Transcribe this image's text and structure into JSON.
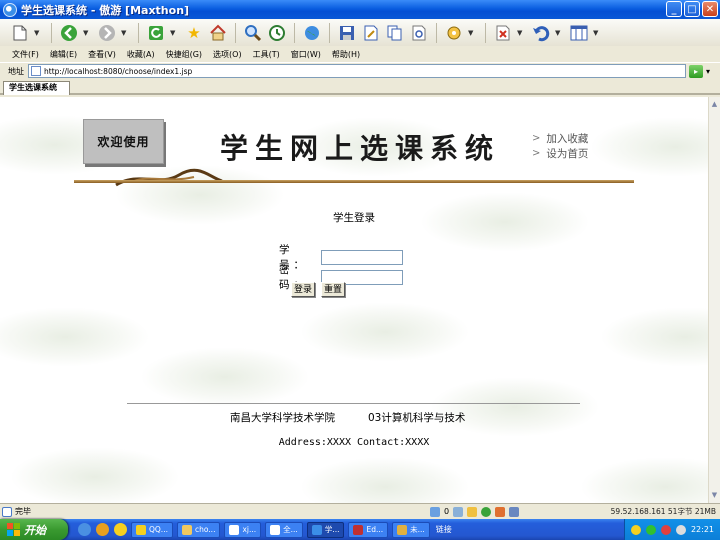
{
  "window": {
    "title": "学生选课系统 - 傲游 [Maxthon]",
    "controls": {
      "minimize": "_",
      "maximize": "□",
      "close": "✕"
    }
  },
  "menu": [
    "文件(F)",
    "编辑(E)",
    "查看(V)",
    "收藏(A)",
    "快捷组(G)",
    "选项(O)",
    "工具(T)",
    "窗口(W)",
    "帮助(H)"
  ],
  "address": {
    "label": "地址",
    "url": "http://localhost:8080/choose/index1.jsp",
    "go": "▸"
  },
  "tab": {
    "label": "学生选课系统"
  },
  "page": {
    "welcome": "欢迎使用",
    "site_title": "学生网上选课系统",
    "links": {
      "favorite": "加入收藏",
      "homepage": "设为首页"
    },
    "login": {
      "heading": "学生登录",
      "id_label": "学 号：",
      "password_label": "密 码：",
      "id_value": "",
      "password_value": "",
      "login_button": "登录",
      "reset_button": "重置"
    },
    "footer": {
      "school": "南昌大学科学技术学院",
      "class": "03计算机科学与技术",
      "contact": "Address:XXXX Contact:XXXX"
    }
  },
  "status": {
    "text": "完毕",
    "count": "0",
    "right": "59.52.168.161 51字节 21MB"
  },
  "taskbar": {
    "start": "开始",
    "tasks": [
      "QQ...",
      "cho...",
      "xj...",
      "全...",
      "学...",
      "Ed...",
      "未..."
    ],
    "links_label": "链接",
    "clock": "22:21"
  },
  "colors": {
    "title_blue": "#0a5ee0",
    "banner_rule": "#b8894a",
    "start_green": "#3a9a30"
  }
}
